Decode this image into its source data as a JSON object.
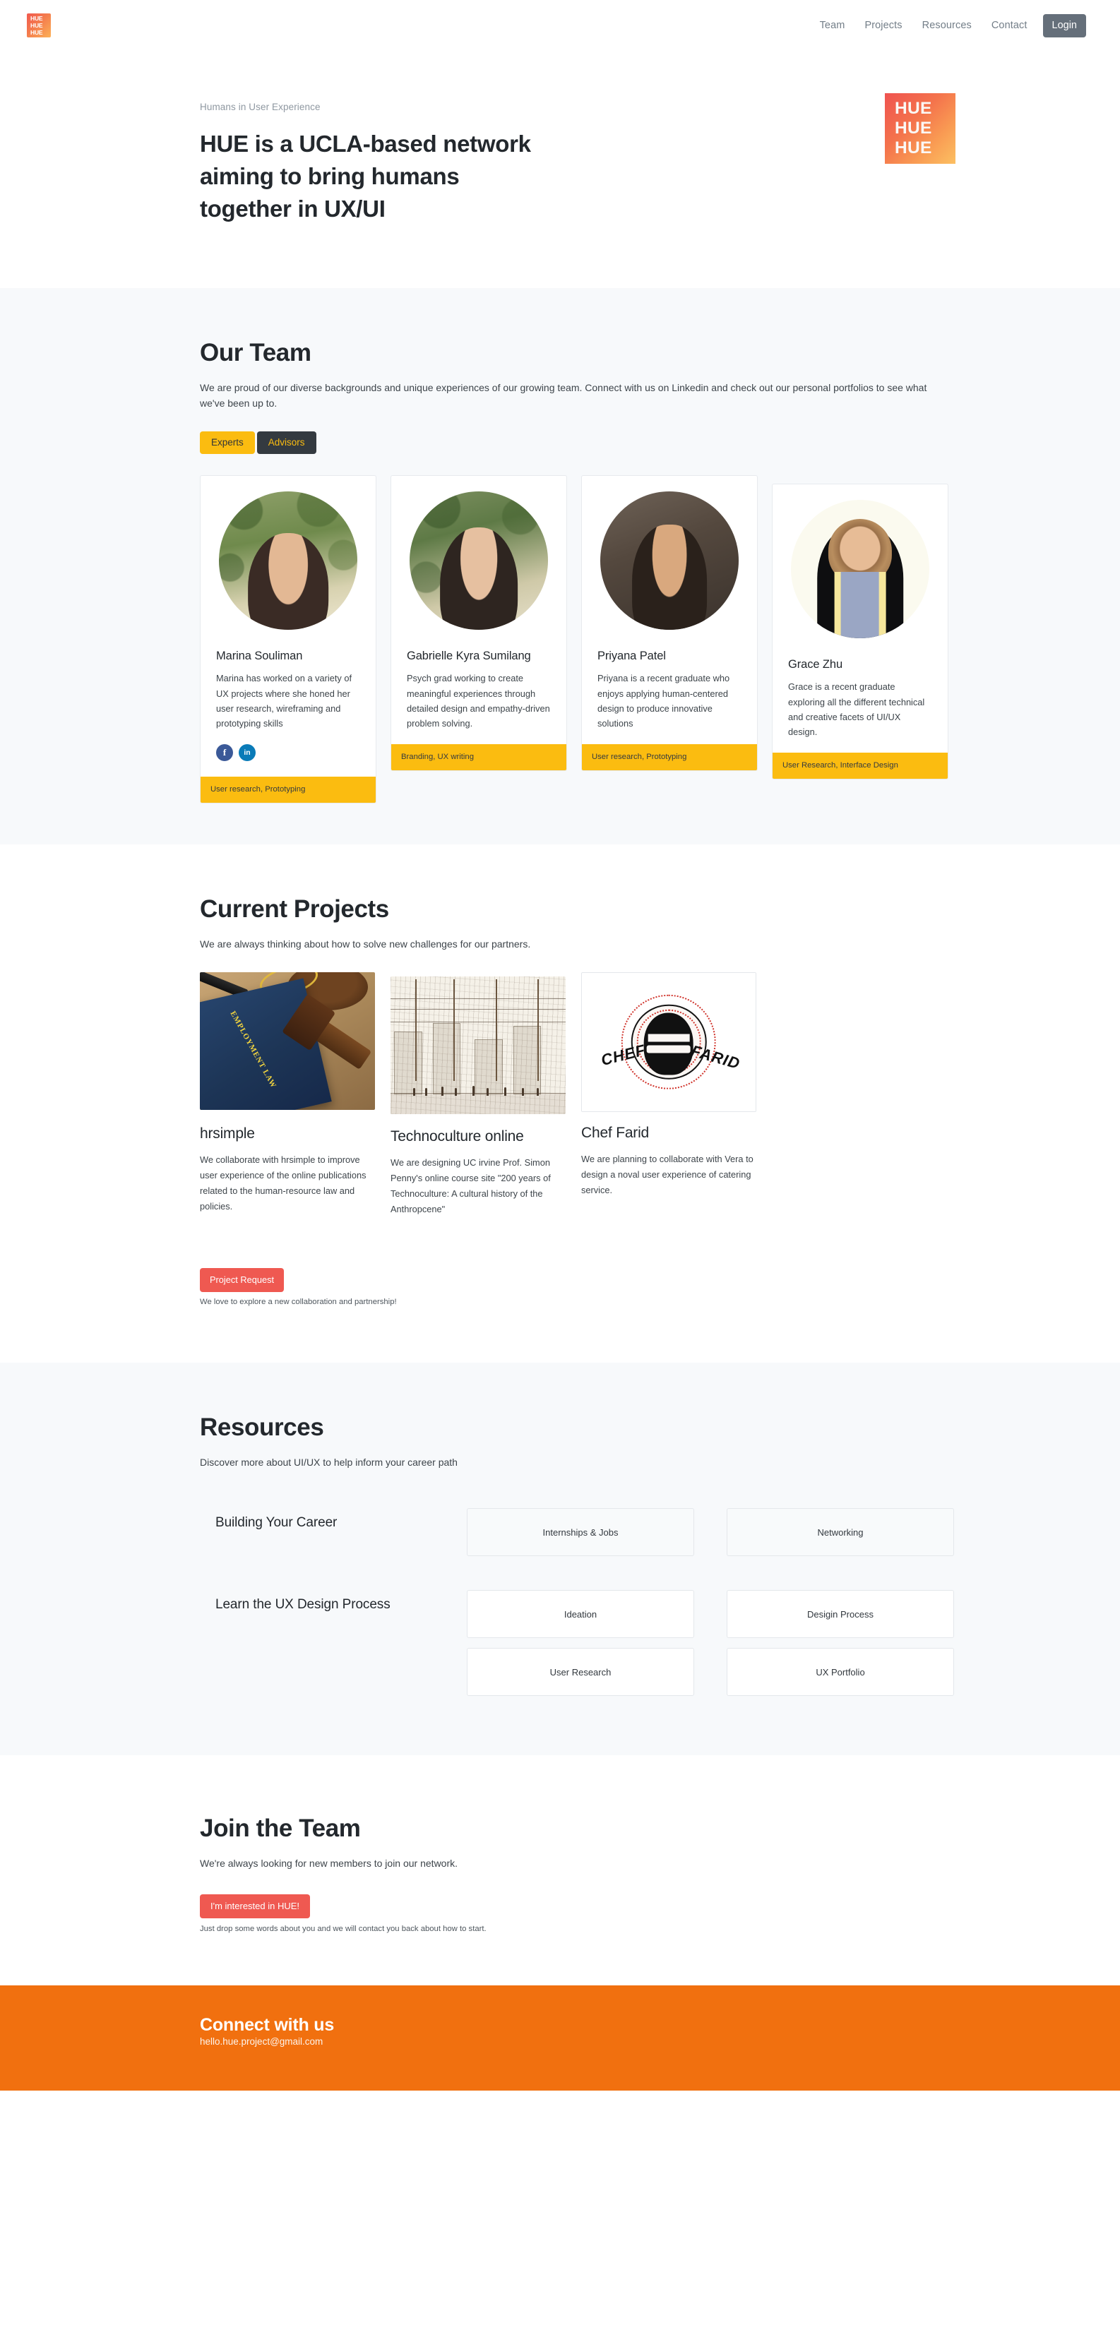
{
  "brand": {
    "logo_lines": [
      "HUE",
      "HUE",
      "HUE"
    ],
    "accent_red": "#ef5951",
    "accent_yellow": "#fbbc10",
    "accent_orange": "#f1700f",
    "gradient_from": "#ef5350",
    "gradient_to": "#fcc062"
  },
  "nav": {
    "logo_name": "hue-logo",
    "items": [
      {
        "label": "Team"
      },
      {
        "label": "Projects"
      },
      {
        "label": "Resources"
      },
      {
        "label": "Contact"
      }
    ],
    "login_label": "Login"
  },
  "hero": {
    "eyebrow": "Humans in User Experience",
    "title": "HUE is a UCLA-based network aiming to bring humans together in UX/UI",
    "logo_lines": [
      "HUE",
      "HUE",
      "HUE"
    ]
  },
  "team": {
    "title": "Our Team",
    "subtitle": "We are proud of our diverse backgrounds and unique experiences of our growing team. Connect with us on Linkedin and check out our personal portfolios to see what we've been up to.",
    "toggles": [
      {
        "label": "Experts",
        "active": true
      },
      {
        "label": "Advisors",
        "active": false
      }
    ],
    "members": [
      {
        "name": "Marina Souliman",
        "bio": "Marina has worked on a variety of UX projects where she honed her user research, wireframing and prototyping skills",
        "skills": "User research, Prototyping",
        "socials": [
          "facebook",
          "linkedin"
        ]
      },
      {
        "name": "Gabrielle Kyra Sumilang",
        "bio": "Psych grad working to create meaningful experiences through detailed design and empathy-driven problem solving.",
        "skills": "Branding, UX writing",
        "socials": []
      },
      {
        "name": "Priyana Patel",
        "bio": "Priyana is a recent graduate who enjoys applying human-centered design to produce innovative solutions",
        "skills": "User research, Prototyping",
        "socials": []
      },
      {
        "name": "Grace Zhu",
        "bio": "Grace is a recent graduate exploring all the different technical and creative facets of UI/UX design.",
        "skills": "User Research, Interface Design",
        "socials": []
      }
    ]
  },
  "projects": {
    "title": "Current Projects",
    "subtitle": "We are always thinking about how to solve new challenges for our partners.",
    "items": [
      {
        "name": "hrsimple",
        "description": "We collaborate with hrsimple to improve user experience of the online publications related to the human-resource law and policies.",
        "thumb_alt": "employment-law-book-photo"
      },
      {
        "name": "Technoculture online",
        "description": "We are designing UC irvine Prof. Simon Penny's online course site \"200 years of Technoculture: A cultural history of the Anthropcene\"",
        "thumb_alt": "street-sketch-illustration"
      },
      {
        "name": "Chef Farid",
        "description": "We are planning to collaborate with Vera to design a noval user experience of catering service.",
        "thumb_alt": "chef-farid-logo"
      }
    ],
    "request_button": "Project Request",
    "request_note": "We love to explore a new collaboration and partnership!"
  },
  "resources": {
    "title": "Resources",
    "subtitle": "Discover more about UI/UX to help inform your career path",
    "groups": [
      {
        "label": "Building Your Career",
        "rows": [
          [
            {
              "label": "Internships & Jobs",
              "style": "ghost"
            },
            {
              "label": "Networking",
              "style": "ghost"
            }
          ]
        ]
      },
      {
        "label": "Learn the UX Design Process",
        "rows": [
          [
            {
              "label": "Ideation",
              "style": "solid"
            },
            {
              "label": "Desigin Process",
              "style": "solid"
            }
          ],
          [
            {
              "label": "User Research",
              "style": "solid"
            },
            {
              "label": "UX Portfolio",
              "style": "solid"
            }
          ]
        ]
      }
    ]
  },
  "join": {
    "title": "Join the Team",
    "subtitle": "We're always looking for new members to join our network.",
    "button": "I'm interested in HUE!",
    "note": "Just drop some words about you and we will contact you back about how to start."
  },
  "footer": {
    "title": "Connect with us",
    "email": "hello.hue.project@gmail.com"
  }
}
